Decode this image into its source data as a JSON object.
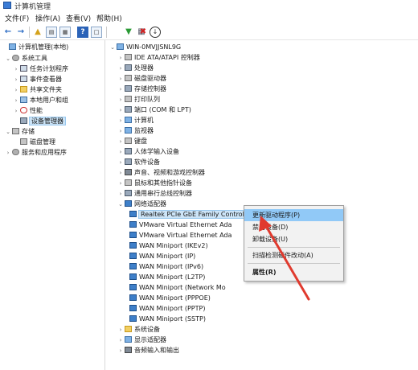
{
  "window": {
    "title": "计算机管理"
  },
  "menu": [
    {
      "name": "menu-file",
      "label": "文件(F)"
    },
    {
      "name": "menu-action",
      "label": "操作(A)"
    },
    {
      "name": "menu-view",
      "label": "查看(V)"
    },
    {
      "name": "menu-help",
      "label": "帮助(H)"
    }
  ],
  "toolbar_icons": [
    "back-arrow-icon",
    "forward-arrow-icon",
    "up-folder-icon",
    "console-tree-icon",
    "properties-icon",
    "help-icon",
    "window-icon",
    "update-driver-icon",
    "uninstall-device-icon",
    "disable-device-icon",
    "scan-hardware-icon"
  ],
  "left_tree": {
    "root": "计算机管理(本地)",
    "system_tools": "系统工具",
    "task_scheduler": "任务计划程序",
    "event_viewer": "事件查看器",
    "shared_folders": "共享文件夹",
    "local_users": "本地用户和组",
    "performance": "性能",
    "device_manager": "设备管理器",
    "storage": "存储",
    "disk_management": "磁盘管理",
    "services": "服务和应用程序"
  },
  "device_tree": {
    "computer_name": "WIN-0MVJJSNL9G",
    "categories_top": [
      "IDE ATA/ATAPI 控制器",
      "处理器",
      "磁盘驱动器",
      "存储控制器",
      "打印队列",
      "端口 (COM 和 LPT)",
      "计算机",
      "监视器",
      "键盘",
      "人体学输入设备",
      "软件设备",
      "声音、视频和游戏控制器",
      "鼠标和其他指针设备",
      "通用串行总线控制器"
    ],
    "network_adapters": "网络适配器",
    "adapters": [
      "Realtek PCIe GbE Family Controller",
      "VMware Virtual Ethernet Ada",
      "VMware Virtual Ethernet Ada",
      "WAN Miniport (IKEv2)",
      "WAN Miniport (IP)",
      "WAN Miniport (IPv6)",
      "WAN Miniport (L2TP)",
      "WAN Miniport (Network Mo",
      "WAN Miniport (PPPOE)",
      "WAN Miniport (PPTP)",
      "WAN Miniport (SSTP)"
    ],
    "categories_bottom": [
      "系统设备",
      "显示适配器",
      "音频输入和输出"
    ]
  },
  "context_menu": {
    "update_driver": "更新驱动程序(P)",
    "disable": "禁用设备(D)",
    "uninstall": "卸载设备(U)",
    "scan": "扫描检测硬件改动(A)",
    "properties": "属性(R)"
  },
  "colors": {
    "highlight": "#91c9f7",
    "selection": "#cce4f7",
    "annotation_arrow": "#e03a2e"
  }
}
